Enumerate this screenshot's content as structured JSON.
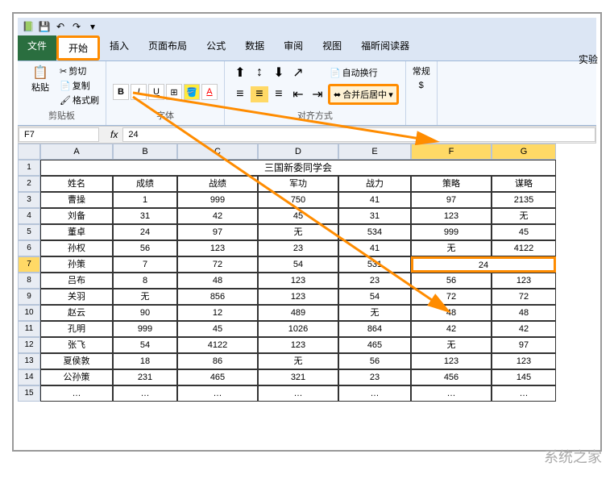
{
  "exp_label": "实验",
  "tabs": {
    "file": "文件",
    "home": "开始",
    "insert": "插入",
    "layout": "页面布局",
    "formula": "公式",
    "data": "数据",
    "review": "审阅",
    "view": "视图",
    "foxit": "福昕阅读器"
  },
  "ribbon": {
    "clipboard": {
      "paste": "粘贴",
      "cut": "剪切",
      "copy": "复制",
      "format": "格式刷",
      "label": "剪贴板"
    },
    "font_label": "字体",
    "align": {
      "wrap": "自动换行",
      "merge": "合并后居中",
      "label": "对齐方式"
    },
    "number": {
      "general": "常规"
    }
  },
  "namebox": "F7",
  "formula": "24",
  "cols": [
    "A",
    "B",
    "C",
    "D",
    "E",
    "F",
    "G"
  ],
  "title_row": "三国新委同学会",
  "header_row": [
    "姓名",
    "成绩",
    "战绩",
    "军功",
    "战力",
    "策略",
    "谋略"
  ],
  "data": [
    [
      "曹操",
      "1",
      "999",
      "750",
      "41",
      "97",
      "2135"
    ],
    [
      "刘备",
      "31",
      "42",
      "45",
      "31",
      "123",
      "无"
    ],
    [
      "董卓",
      "24",
      "97",
      "无",
      "534",
      "999",
      "45"
    ],
    [
      "孙权",
      "56",
      "123",
      "23",
      "41",
      "无",
      "4122"
    ],
    [
      "孙策",
      "7",
      "72",
      "54",
      "531",
      "24",
      ""
    ],
    [
      "吕布",
      "8",
      "48",
      "123",
      "23",
      "56",
      "123"
    ],
    [
      "关羽",
      "无",
      "856",
      "123",
      "54",
      "72",
      "72"
    ],
    [
      "赵云",
      "90",
      "12",
      "489",
      "无",
      "48",
      "48"
    ],
    [
      "孔明",
      "999",
      "45",
      "1026",
      "864",
      "42",
      "42"
    ],
    [
      "张飞",
      "54",
      "4122",
      "123",
      "465",
      "无",
      "97"
    ],
    [
      "夏侯敦",
      "18",
      "86",
      "无",
      "56",
      "123",
      "123"
    ],
    [
      "公孙策",
      "231",
      "465",
      "321",
      "23",
      "456",
      "145"
    ],
    [
      "…",
      "…",
      "…",
      "…",
      "…",
      "…",
      "…"
    ]
  ],
  "merged_value": "24",
  "watermark": "系统之家"
}
